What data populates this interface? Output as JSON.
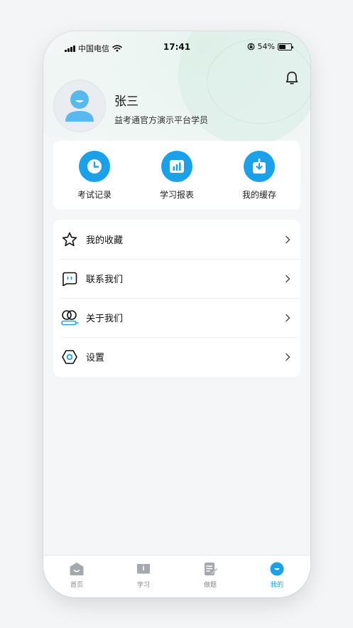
{
  "status_bar": {
    "carrier": "中国电信",
    "time": "17:41",
    "battery": "54%",
    "battery_level": 0.54
  },
  "profile": {
    "name": "张三",
    "subtitle": "益考通官方演示平台学员"
  },
  "quick_actions": [
    {
      "label": "考试记录",
      "icon": "clock-icon"
    },
    {
      "label": "学习报表",
      "icon": "chart-icon"
    },
    {
      "label": "我的缓存",
      "icon": "download-icon"
    }
  ],
  "menu": [
    {
      "label": "我的收藏",
      "icon": "star-icon"
    },
    {
      "label": "联系我们",
      "icon": "chat-icon"
    },
    {
      "label": "关于我们",
      "icon": "about-icon"
    },
    {
      "label": "设置",
      "icon": "settings-icon"
    }
  ],
  "tabs": [
    {
      "label": "首页",
      "icon": "home-icon",
      "active": false
    },
    {
      "label": "学习",
      "icon": "book-icon",
      "active": false
    },
    {
      "label": "做题",
      "icon": "exercise-icon",
      "active": false
    },
    {
      "label": "我的",
      "icon": "profile-icon",
      "active": true
    }
  ],
  "colors": {
    "accent": "#1aa1ea",
    "tab_inactive": "#a4a9af"
  }
}
